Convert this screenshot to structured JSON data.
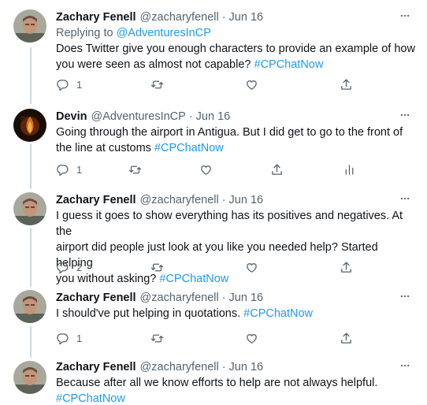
{
  "thread": [
    {
      "avatar": "zachary-avatar",
      "name": "Zachary Fenell",
      "handle": "@zacharyfenell",
      "dot": "·",
      "time": "Jun 16",
      "reply_prefix": "Replying to",
      "reply_to": "@AdventuresInCP",
      "text_line1": "Does Twitter give you enough characters to provide an example of how",
      "text_line2": "you were seen as almost not capable?",
      "hashtag": "#CPChatNow",
      "reply_count": "1",
      "has_analytics": false
    },
    {
      "avatar": "devin-avatar",
      "name": "Devin",
      "handle": "@AdventuresInCP",
      "dot": "·",
      "time": "Jun 16",
      "text_line1": "Going through the airport in Antigua. But I did get to go to the front of",
      "text_line2": "the line at customs",
      "hashtag": "#CPChatNow",
      "reply_count": "1",
      "has_analytics": true
    },
    {
      "avatar": "zachary-avatar",
      "name": "Zachary Fenell",
      "handle": "@zacharyfenell",
      "dot": "·",
      "time": "Jun 16",
      "text_line1": "I guess it goes to show everything has its positives and negatives. At the",
      "text_line2": "airport did people just look at you like you needed help? Started helping",
      "text_line3": "you without asking?",
      "hashtag": "#CPChatNow",
      "reply_count": "2",
      "has_analytics": false
    },
    {
      "avatar": "zachary-avatar",
      "name": "Zachary Fenell",
      "handle": "@zacharyfenell",
      "dot": "·",
      "time": "Jun 16",
      "text_line1": "I should've put helping in quotations.",
      "hashtag": "#CPChatNow",
      "reply_count": "1",
      "has_analytics": false
    },
    {
      "avatar": "zachary-avatar",
      "name": "Zachary Fenell",
      "handle": "@zacharyfenell",
      "dot": "·",
      "time": "Jun 16",
      "text_line1": "Because after all we know efforts to help are not always helpful.",
      "hashtag": "#CPChatNow"
    }
  ],
  "colors": {
    "link": "#1d9bf0",
    "muted": "#536471",
    "thread_line": "#cfd9de"
  },
  "icons": [
    "reply-icon",
    "retweet-icon",
    "like-icon",
    "share-icon",
    "analytics-icon",
    "more-icon"
  ]
}
